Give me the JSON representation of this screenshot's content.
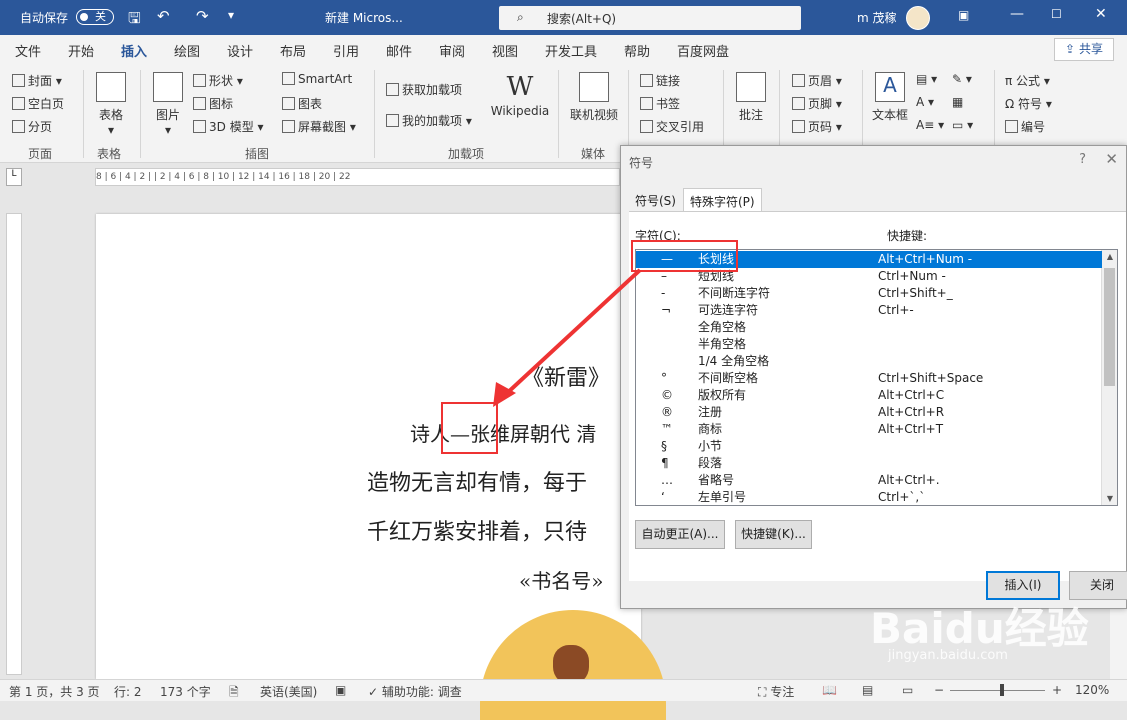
{
  "titlebar": {
    "autosave_label": "自动保存",
    "autosave_state": "关",
    "doc_title": "新建 Micros...",
    "search_placeholder": "搜索(Alt+Q)",
    "user": "m 茂稼"
  },
  "tabs": [
    "文件",
    "开始",
    "插入",
    "绘图",
    "设计",
    "布局",
    "引用",
    "邮件",
    "审阅",
    "视图",
    "开发工具",
    "帮助",
    "百度网盘"
  ],
  "share_label": "共享",
  "ribbon": {
    "pages": {
      "items": [
        "封面",
        "空白页",
        "分页"
      ],
      "group": "页面"
    },
    "tables": {
      "label": "表格",
      "group": "表格"
    },
    "illustrations": {
      "picture": "图片",
      "items": [
        "形状",
        "图标",
        "3D 模型"
      ],
      "items2": [
        "SmartArt",
        "图表",
        "屏幕截图"
      ],
      "group": "插图"
    },
    "addins": {
      "get": "获取加载项",
      "mine": "我的加载项",
      "wiki": "Wikipedia",
      "group": "加载项"
    },
    "media": {
      "video": "联机视频",
      "group": "媒体"
    },
    "links": {
      "items": [
        "链接",
        "书签",
        "交叉引用"
      ]
    },
    "comments": {
      "label": "批注"
    },
    "headerfooter": {
      "items": [
        "页眉",
        "页脚",
        "页码"
      ]
    },
    "text": {
      "textbox": "文本框"
    },
    "symbols": {
      "items": [
        "公式",
        "符号",
        "编号"
      ]
    }
  },
  "ruler_marks": "8 | 6 | 4 | 2 |   | 2 | 4 | 6 | 8 | 10 | 12 | 14 | 16 | 18 | 20 | 22",
  "document": {
    "lines": [
      "《新雷》",
      "诗人—张维屏朝代  清",
      "造物无言却有情，每于",
      "千红万紫安排着，只待",
      "«书名号»"
    ]
  },
  "dialog": {
    "title": "符号",
    "help": "?",
    "close": "✕",
    "tabs": [
      "符号(S)",
      "特殊字符(P)"
    ],
    "col_char": "字符(C):",
    "col_key": "快捷键:",
    "rows": [
      {
        "sym": "—",
        "name": "长划线",
        "key": "Alt+Ctrl+Num -",
        "selected": true
      },
      {
        "sym": "–",
        "name": "短划线",
        "key": "Ctrl+Num -"
      },
      {
        "sym": "-",
        "name": "不间断连字符",
        "key": "Ctrl+Shift+_"
      },
      {
        "sym": "¬",
        "name": "可选连字符",
        "key": "Ctrl+-"
      },
      {
        "sym": "",
        "name": "全角空格",
        "key": ""
      },
      {
        "sym": "",
        "name": "半角空格",
        "key": ""
      },
      {
        "sym": "",
        "name": "1/4 全角空格",
        "key": ""
      },
      {
        "sym": "°",
        "name": "不间断空格",
        "key": "Ctrl+Shift+Space"
      },
      {
        "sym": "©",
        "name": "版权所有",
        "key": "Alt+Ctrl+C"
      },
      {
        "sym": "®",
        "name": "注册",
        "key": "Alt+Ctrl+R"
      },
      {
        "sym": "™",
        "name": "商标",
        "key": "Alt+Ctrl+T"
      },
      {
        "sym": "§",
        "name": "小节",
        "key": ""
      },
      {
        "sym": "¶",
        "name": "段落",
        "key": ""
      },
      {
        "sym": "…",
        "name": "省略号",
        "key": "Alt+Ctrl+."
      },
      {
        "sym": "‘",
        "name": "左单引号",
        "key": "Ctrl+`,`"
      }
    ],
    "autocorrect": "自动更正(A)...",
    "shortcut": "快捷键(K)...",
    "insert": "插入(I)",
    "close_btn": "关闭"
  },
  "status": {
    "page": "第 1 页，共 3 页",
    "line": "行: 2",
    "words": "173 个字",
    "lang": "英语(美国)",
    "access": "辅助功能: 调查",
    "focus": "专注",
    "zoom": "120%"
  },
  "watermark": {
    "brand": "Baidu经验",
    "url": "jingyan.baidu.com"
  }
}
